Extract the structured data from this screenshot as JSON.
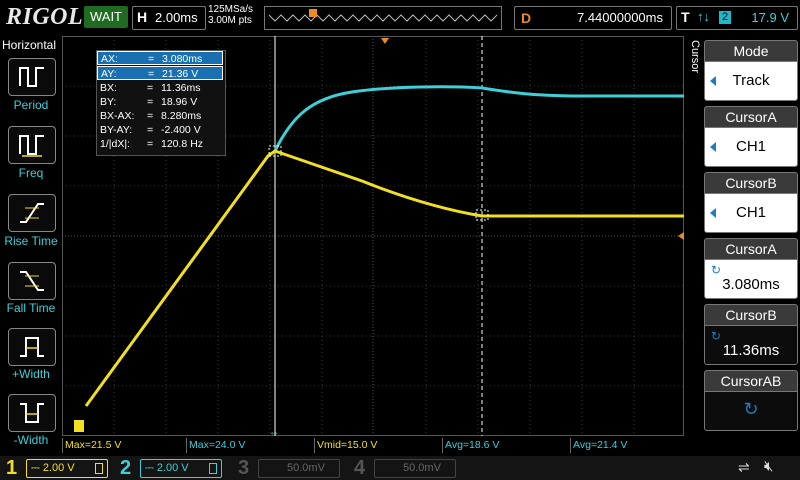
{
  "app": {
    "brand": "RIGOL",
    "status": "WAIT"
  },
  "horizontal": {
    "key": "H",
    "timebase": "2.00ms",
    "sample_rate": "125MSa/s",
    "memory_depth": "3.00M pts"
  },
  "delay": {
    "key": "D",
    "value": "7.44000000ms"
  },
  "trigger": {
    "key": "T",
    "arrows": "↑↓",
    "source": "2",
    "level": "17.9 V"
  },
  "left_menu": {
    "title": "Horizontal",
    "items": [
      {
        "label": "Period"
      },
      {
        "label": "Freq"
      },
      {
        "label": "Rise Time"
      },
      {
        "label": "Fall Time"
      },
      {
        "label": "+Width"
      },
      {
        "label": "-Width"
      }
    ]
  },
  "cursor_table": {
    "rows": [
      {
        "name": "AX:",
        "eq": "=",
        "value": "3.080ms"
      },
      {
        "name": "AY:",
        "eq": "=",
        "value": "21.36 V"
      },
      {
        "name": "BX:",
        "eq": "=",
        "value": "11.36ms"
      },
      {
        "name": "BY:",
        "eq": "=",
        "value": "18.96 V"
      },
      {
        "name": "BX-AX:",
        "eq": "=",
        "value": "8.280ms"
      },
      {
        "name": "BY-AY:",
        "eq": "=",
        "value": "-2.400 V"
      },
      {
        "name": "1/|dX|:",
        "eq": "=",
        "value": "120.8 Hz"
      }
    ]
  },
  "measurements": [
    {
      "label": "Max=21.5 V",
      "color": "#f0e020"
    },
    {
      "label": "Max=24.0 V",
      "color": "#3ecfd8"
    },
    {
      "label": "Vmid=15.0 V",
      "color": "#f0e020"
    },
    {
      "label": "Avg=18.6 V",
      "color": "#3ecfd8"
    },
    {
      "label": "Avg=21.4 V",
      "color": "#3ecfd8"
    }
  ],
  "right_menu": {
    "tab_label": "Cursor",
    "items": [
      {
        "header": "Mode",
        "value": "Track"
      },
      {
        "header": "CursorA",
        "value": "CH1"
      },
      {
        "header": "CursorB",
        "value": "CH1"
      },
      {
        "header": "CursorA",
        "value": "3.080ms"
      },
      {
        "header": "CursorB",
        "value": "11.36ms"
      },
      {
        "header": "CursorAB",
        "value": ""
      }
    ]
  },
  "channels": [
    {
      "num": "1",
      "scale": "2.00 V",
      "color": "#f0e020",
      "active": true
    },
    {
      "num": "2",
      "scale": "2.00 V",
      "color": "#3ecfd8",
      "active": true
    },
    {
      "num": "3",
      "scale": "50.0mV",
      "color": "#c040c0",
      "active": false
    },
    {
      "num": "4",
      "scale": "50.0mV",
      "color": "#3070d0",
      "active": false
    }
  ],
  "colors": {
    "ch1": "#f0e020",
    "ch2": "#3ecfd8",
    "marker": "#e98a2b",
    "grid": "#3a3a3a",
    "select": "#1a6fb0"
  }
}
